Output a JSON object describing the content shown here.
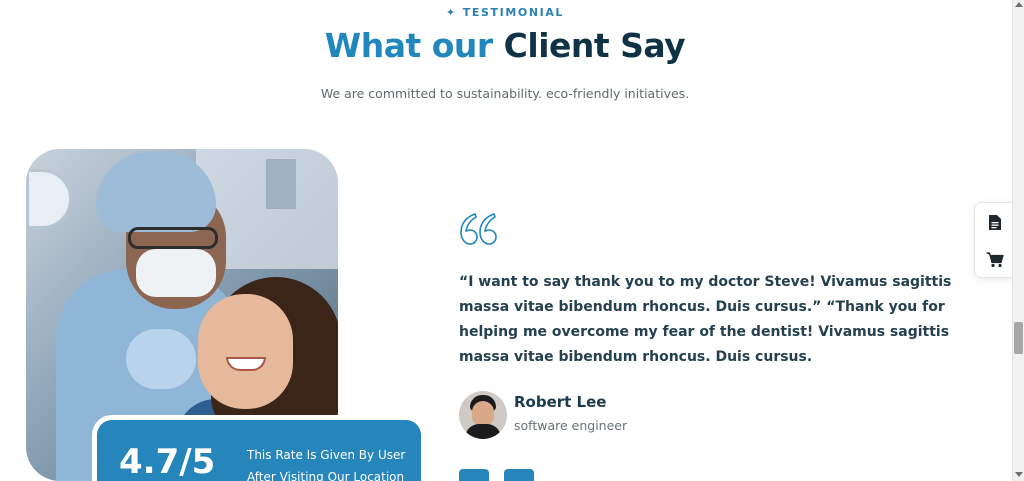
{
  "section": {
    "eyebrow_icon": "✦",
    "eyebrow": "TESTIMONIAL",
    "title_accent": "What our",
    "title_dark": "Client Say",
    "subtitle": "We are committed to sustainability. eco-friendly initiatives."
  },
  "rating": {
    "score": "4.7/5",
    "text": "This Rate Is Given By User After Visiting Our Location"
  },
  "testimonial": {
    "quote": "“I want to say thank you to my doctor Steve! Vivamus sagittis massa vitae bibendum rhoncus. Duis cursus.” “Thank you for helping me overcome my fear of the dentist! Vivamus sagittis massa vitae bibendum rhoncus. Duis cursus.",
    "author_name": "Robert Lee",
    "author_role": "software engineer"
  },
  "navigation": {
    "prev_icon": "chevron-left-icon",
    "next_icon": "chevron-right-icon",
    "prev_glyph": "‹",
    "next_glyph": "›"
  },
  "side_panel": {
    "items": [
      {
        "icon": "document-icon"
      },
      {
        "icon": "cart-icon"
      }
    ]
  },
  "colors": {
    "accent": "#2287bd",
    "dark": "#0f3246",
    "badge": "#2685ba"
  }
}
